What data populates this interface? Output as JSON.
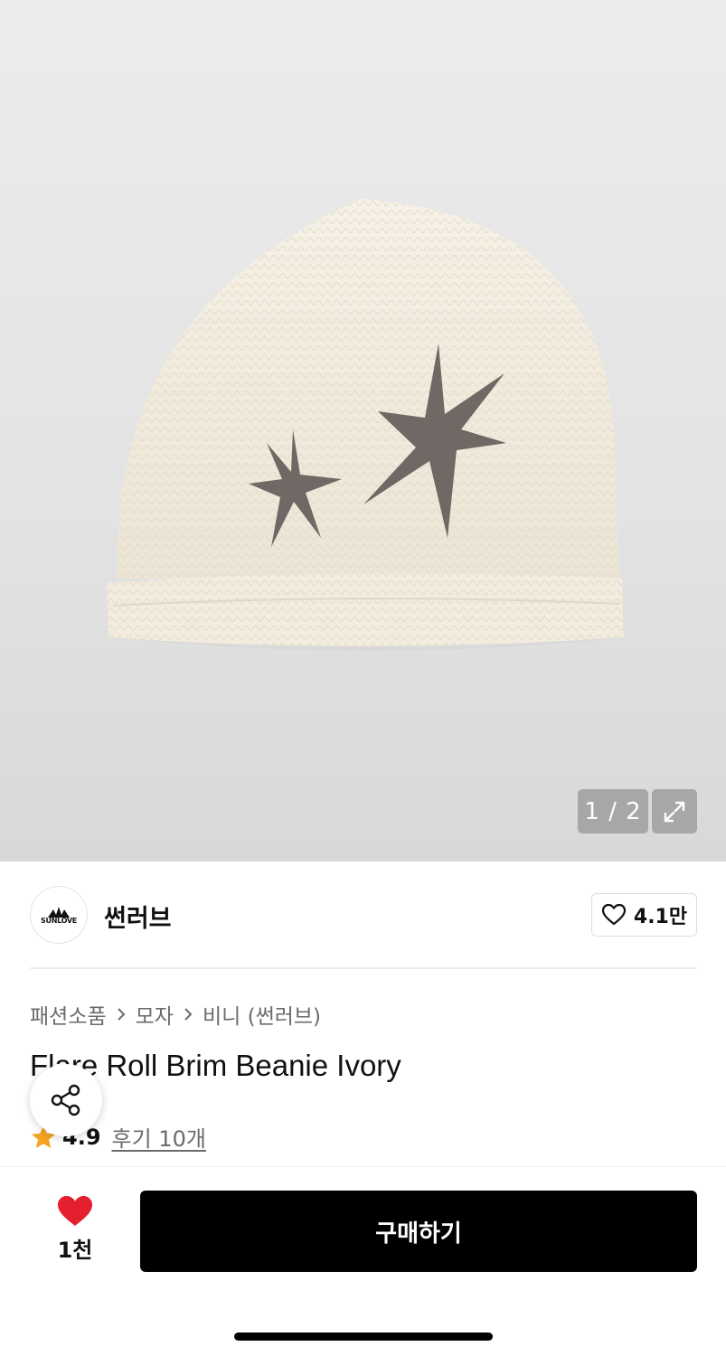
{
  "gallery": {
    "pager_text": "1 / 2",
    "image_icon": "beanie-product-image",
    "expand_icon": "expand-icon"
  },
  "brand": {
    "logo_text": "SUNLOVE",
    "name": "썬러브",
    "like_count": "4.1만"
  },
  "breadcrumb": {
    "items": [
      "패션소품",
      "모자",
      "비니 (썬러브)"
    ]
  },
  "product": {
    "title": "Flare Roll Brim Beanie Ivory",
    "rating": "4.9",
    "reviews_label": "후기 10개"
  },
  "bottom_bar": {
    "wish_count": "1천",
    "buy_label": "구매하기"
  },
  "colors": {
    "accent_black": "#000000",
    "heart_red": "#e5202e",
    "star_orange": "#f5a524"
  }
}
